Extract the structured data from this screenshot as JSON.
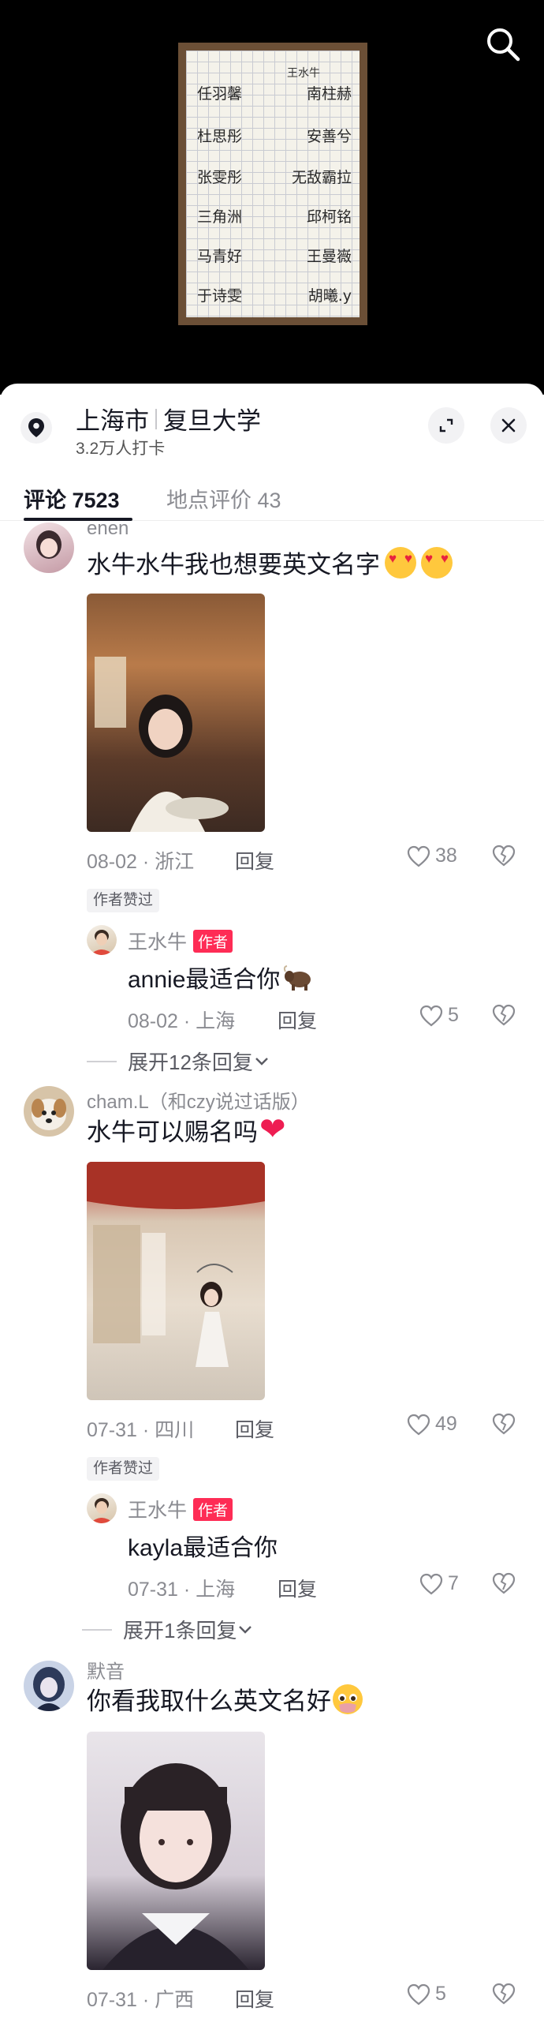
{
  "location": {
    "city": "上海市",
    "place": "复旦大学",
    "checkins": "3.2万人打卡"
  },
  "note": {
    "header": "王水牛",
    "rows": [
      [
        "任羽馨",
        "南柱赫"
      ],
      [
        "杜思彤",
        "安善兮"
      ],
      [
        "张雯彤",
        "无敌霸拉"
      ],
      [
        "三角洲",
        "邱柯铭"
      ],
      [
        "马青好",
        "王曼嶶"
      ],
      [
        "于诗雯",
        "胡曦.y"
      ]
    ]
  },
  "tabs": [
    {
      "label": "评论 7523"
    },
    {
      "label": "地点评价 43"
    }
  ],
  "comments": [
    {
      "user": "enen",
      "text": "水牛水牛我也想要英文名字",
      "date_region": "08-02 · 浙江",
      "reply_label": "回复",
      "likes": "38",
      "liked_badge": "作者赞过",
      "author_reply": {
        "user": "王水牛",
        "tag": "作者",
        "text": "annie最适合你",
        "date_region": "08-02 · 上海",
        "reply_label": "回复",
        "likes": "5"
      },
      "expand_label": "展开12条回复"
    },
    {
      "user": "cham.L（和czy说过话版）",
      "text": "水牛可以赐名吗",
      "date_region": "07-31 · 四川",
      "reply_label": "回复",
      "likes": "49",
      "liked_badge": "作者赞过",
      "author_reply": {
        "user": "王水牛",
        "tag": "作者",
        "text": "kayla最适合你",
        "date_region": "07-31 · 上海",
        "reply_label": "回复",
        "likes": "7"
      },
      "expand_label": "展开1条回复"
    },
    {
      "user": "默音",
      "text": "你看我取什么英文名好",
      "date_region": "07-31 · 广西",
      "reply_label": "回复",
      "likes": "5"
    }
  ],
  "colors": {
    "author_tag": "#fe2c55",
    "text_primary": "#161823",
    "text_secondary": "#8a8b91"
  }
}
